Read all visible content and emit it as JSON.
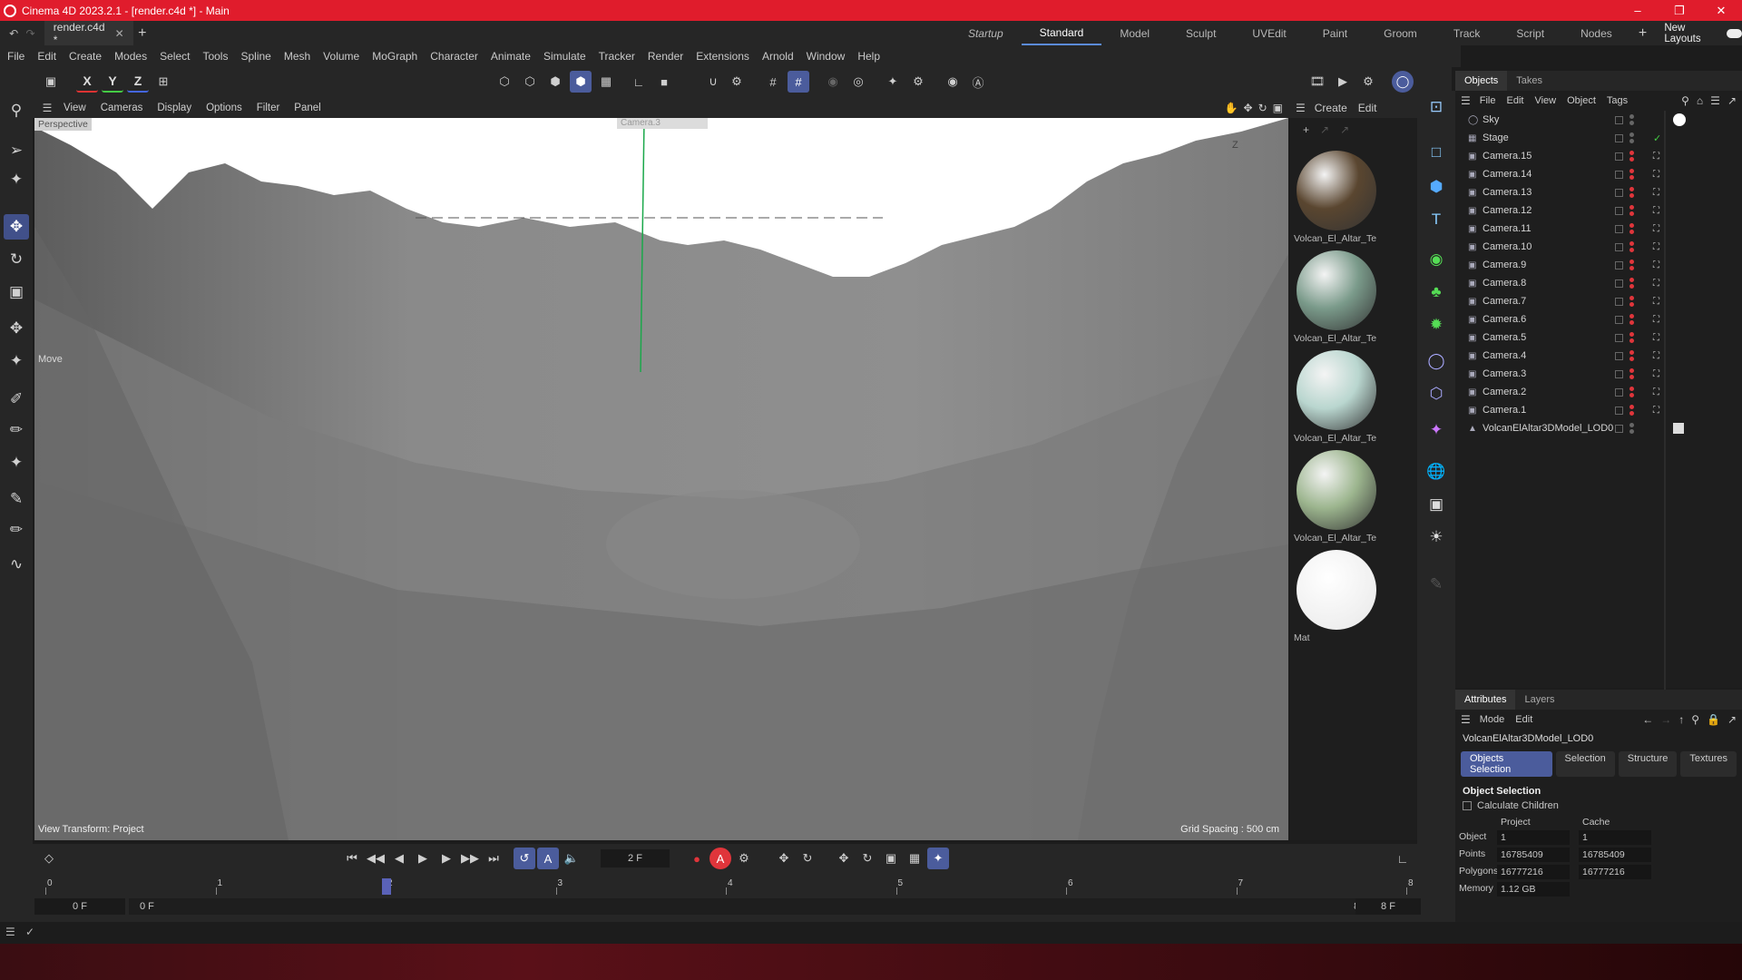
{
  "app": {
    "window_title": "Cinema 4D 2023.2.1 - [render.c4d *] - Main",
    "document_tab": "render.c4d *",
    "layouts": [
      "Startup",
      "Standard",
      "Model",
      "Sculpt",
      "UVEdit",
      "Paint",
      "Groom",
      "Track",
      "Script",
      "Nodes"
    ],
    "active_layout": "Standard",
    "new_layouts_label": "New Layouts"
  },
  "menu": [
    "File",
    "Edit",
    "Create",
    "Modes",
    "Select",
    "Tools",
    "Spline",
    "Mesh",
    "Volume",
    "MoGraph",
    "Character",
    "Animate",
    "Simulate",
    "Tracker",
    "Render",
    "Extensions",
    "Arnold",
    "Window",
    "Help"
  ],
  "toolbar": {
    "axis_x": "X",
    "axis_y": "Y",
    "axis_z": "Z"
  },
  "viewport": {
    "menu": [
      "View",
      "Cameras",
      "Display",
      "Options",
      "Filter",
      "Panel"
    ],
    "camera_label": "Perspective",
    "camera_overlay": "Camera.3",
    "axis_z": "Z",
    "tool_label": "Move",
    "view_transform": "View Transform: Project",
    "grid_spacing": "Grid Spacing : 500 cm"
  },
  "materials": {
    "menu": [
      "Create",
      "Edit"
    ],
    "items": [
      {
        "label": "Volcan_El_Altar_Te",
        "color": "#5a4630"
      },
      {
        "label": "Volcan_El_Altar_Te",
        "color": "#7a9a8a"
      },
      {
        "label": "Volcan_El_Altar_Te",
        "color": "#b9d6cf"
      },
      {
        "label": "Volcan_El_Altar_Te",
        "color": "#9cb58e"
      },
      {
        "label": "Mat",
        "color": "#ffffff"
      }
    ]
  },
  "objects": {
    "tabs": [
      "Objects",
      "Takes"
    ],
    "menu": [
      "File",
      "Edit",
      "View",
      "Object",
      "Tags"
    ],
    "items": [
      {
        "name": "Sky",
        "icon": "sky-icon"
      },
      {
        "name": "Stage",
        "icon": "stage-icon"
      },
      {
        "name": "Camera.15",
        "icon": "camera-icon"
      },
      {
        "name": "Camera.14",
        "icon": "camera-icon"
      },
      {
        "name": "Camera.13",
        "icon": "camera-icon"
      },
      {
        "name": "Camera.12",
        "icon": "camera-icon"
      },
      {
        "name": "Camera.11",
        "icon": "camera-icon"
      },
      {
        "name": "Camera.10",
        "icon": "camera-icon"
      },
      {
        "name": "Camera.9",
        "icon": "camera-icon"
      },
      {
        "name": "Camera.8",
        "icon": "camera-icon"
      },
      {
        "name": "Camera.7",
        "icon": "camera-icon"
      },
      {
        "name": "Camera.6",
        "icon": "camera-icon"
      },
      {
        "name": "Camera.5",
        "icon": "camera-icon"
      },
      {
        "name": "Camera.4",
        "icon": "camera-icon"
      },
      {
        "name": "Camera.3",
        "icon": "camera-icon"
      },
      {
        "name": "Camera.2",
        "icon": "camera-icon"
      },
      {
        "name": "Camera.1",
        "icon": "camera-icon"
      },
      {
        "name": "VolcanElAltar3DModel_LOD0",
        "icon": "polygon-object-icon"
      }
    ]
  },
  "attributes": {
    "tabs": [
      "Attributes",
      "Layers"
    ],
    "menu": [
      "Mode",
      "Edit"
    ],
    "object_name": "VolcanElAltar3DModel_LOD0",
    "subtabs": [
      "Objects Selection",
      "Selection",
      "Structure",
      "Textures"
    ],
    "active_subtab": "Objects Selection",
    "section_title": "Object Selection",
    "calculate_children": "Calculate Children",
    "col_project": "Project",
    "col_cache": "Cache",
    "rows": [
      {
        "label": "Object",
        "project": "1",
        "cache": "1"
      },
      {
        "label": "Points",
        "project": "16785409",
        "cache": "16785409"
      },
      {
        "label": "Polygons",
        "project": "16777216",
        "cache": "16777216"
      },
      {
        "label": "Memory",
        "project": "1.12 GB",
        "cache": ""
      }
    ]
  },
  "timeline": {
    "current_frame": "2 F",
    "ticks": [
      "0",
      "1",
      "2",
      "3",
      "4",
      "5",
      "6",
      "7",
      "8"
    ],
    "current_tick": 2,
    "start_min": "0 F",
    "start": "0 F",
    "end": "8 F",
    "end_max": "8 F"
  },
  "colors": {
    "accent": "#4b5c9c",
    "titlebar": "#e01c2c",
    "record": "#e0353b"
  }
}
